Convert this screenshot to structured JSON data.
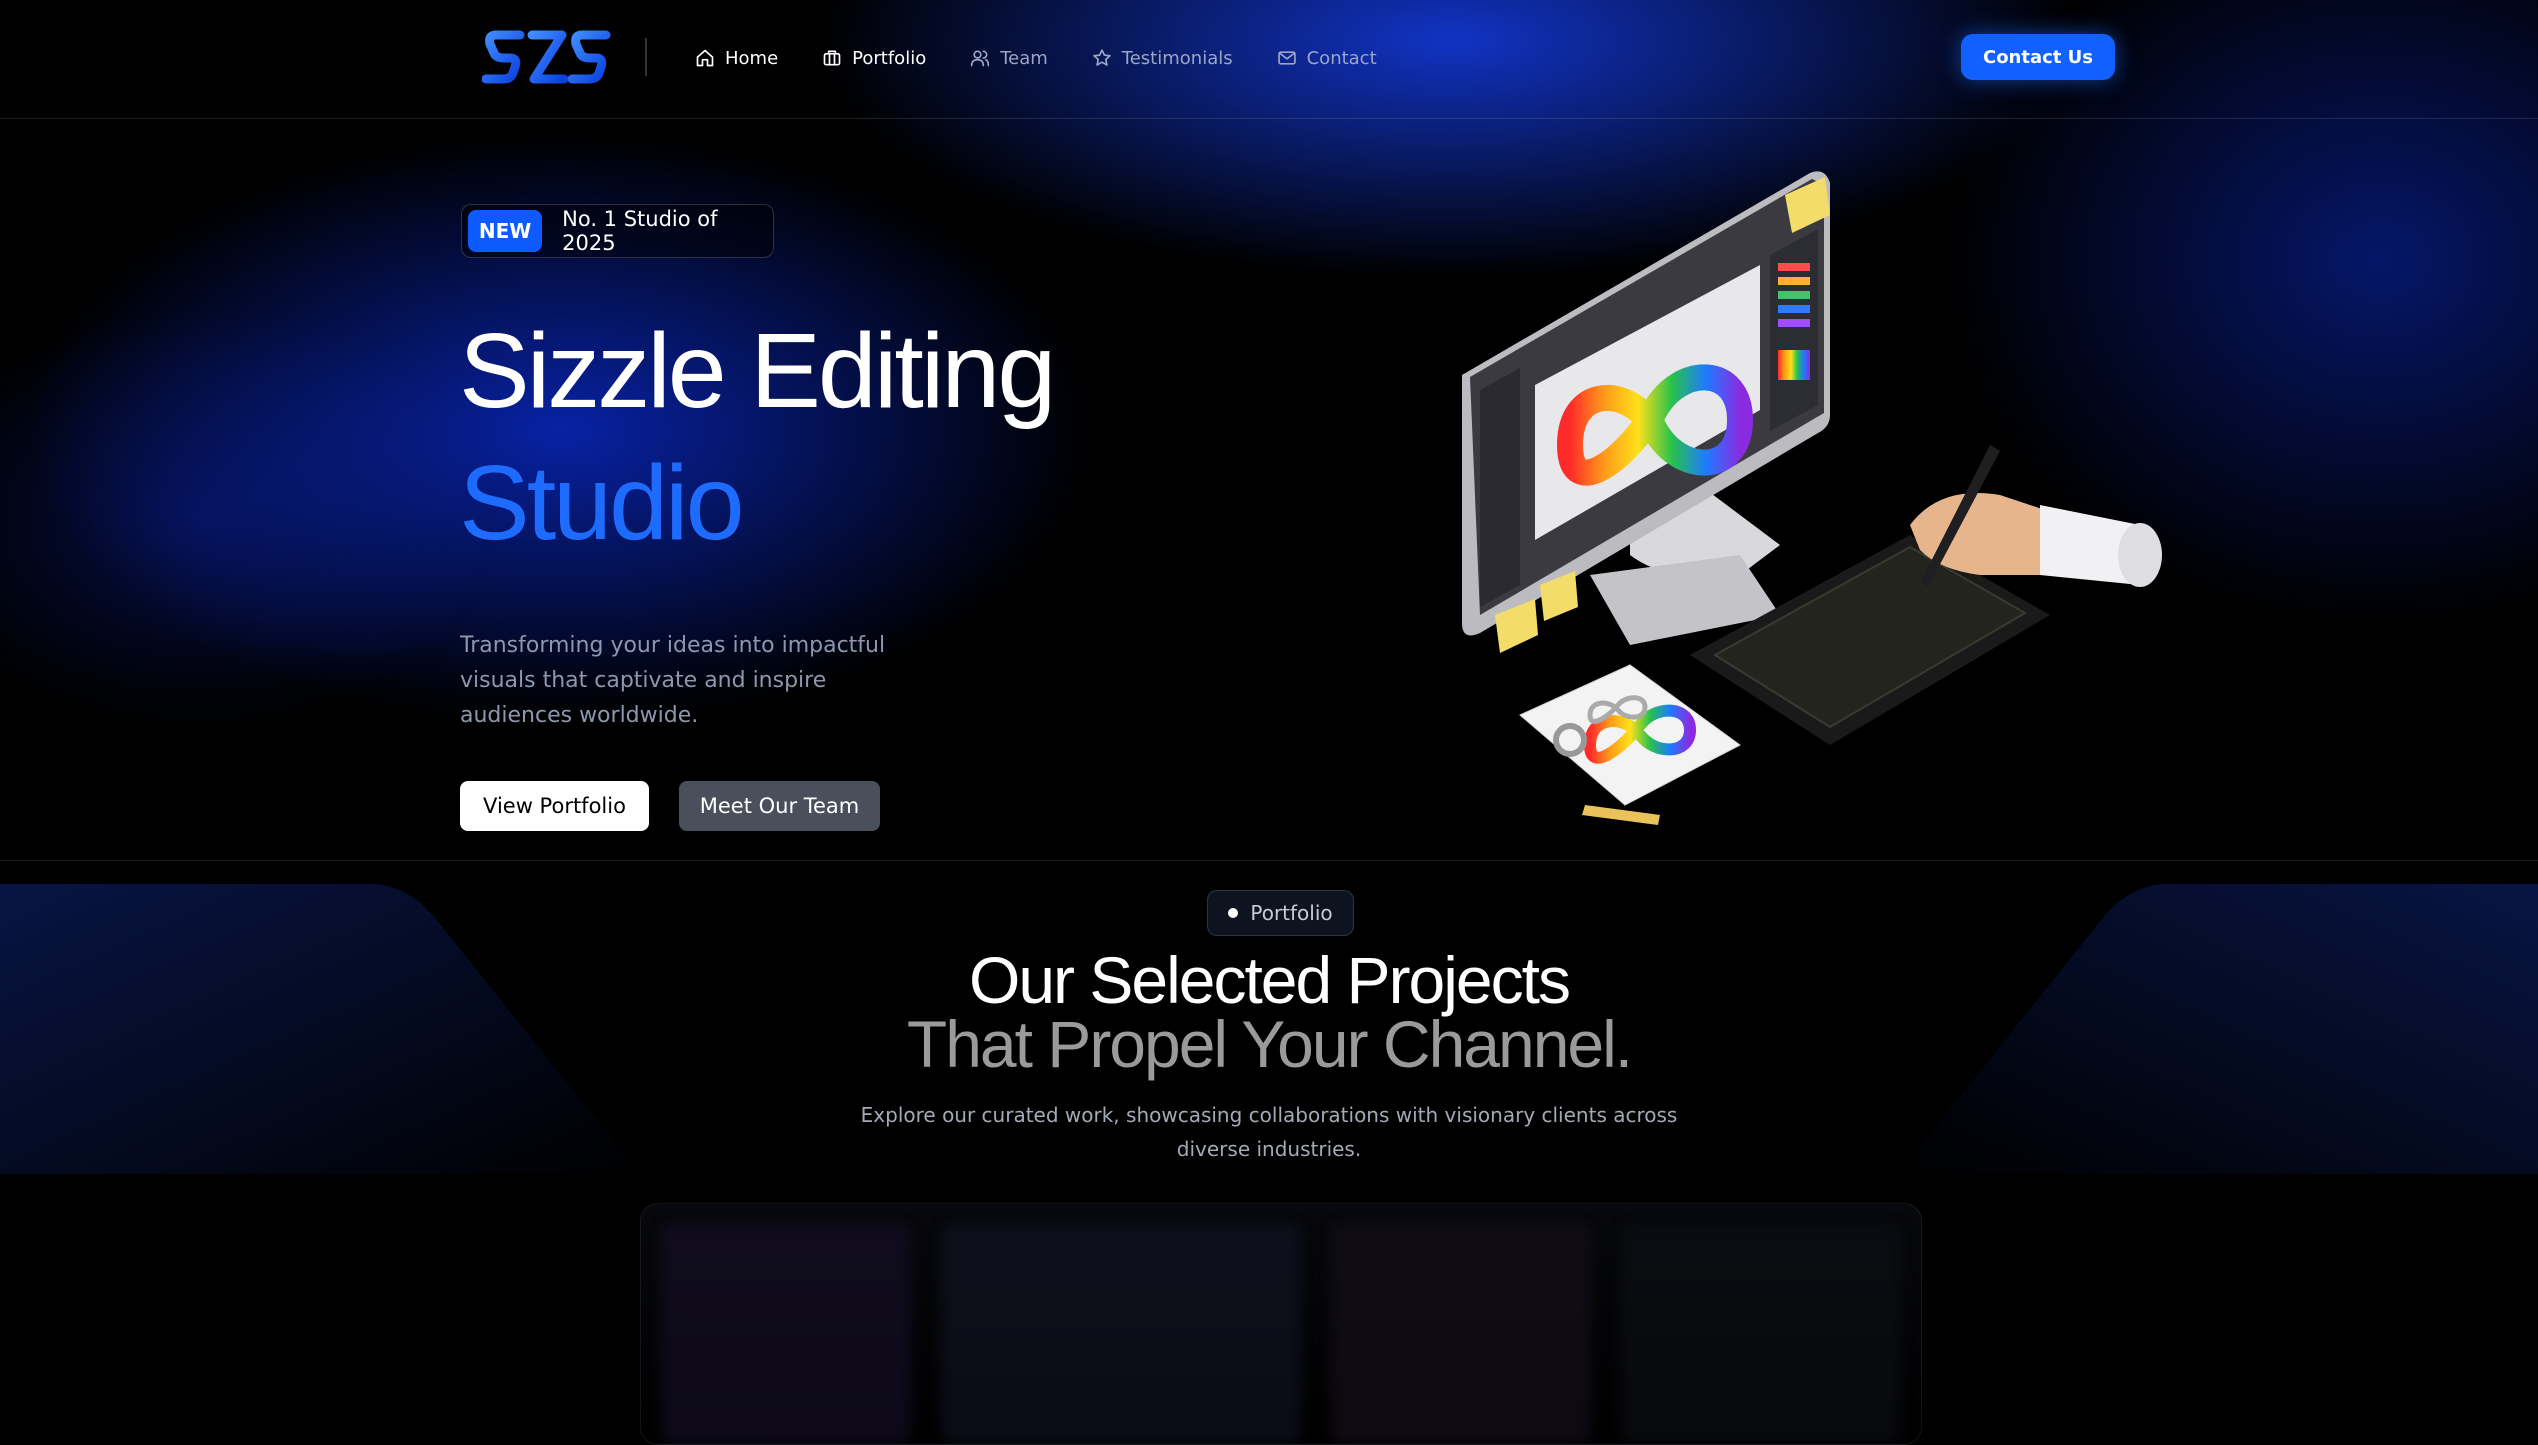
{
  "nav": {
    "logo_text": "SZS",
    "items": [
      {
        "label": "Home",
        "icon": "home-icon",
        "active": true
      },
      {
        "label": "Portfolio",
        "icon": "briefcase-icon",
        "active": false
      },
      {
        "label": "Team",
        "icon": "users-icon",
        "active": false
      },
      {
        "label": "Testimonials",
        "icon": "star-icon",
        "active": false
      },
      {
        "label": "Contact",
        "icon": "mail-icon",
        "active": false
      }
    ],
    "cta_label": "Contact Us"
  },
  "hero": {
    "badge_new": "NEW",
    "badge_text": "No. 1 Studio of 2025",
    "title_line1": "Sizzle Editing",
    "title_line2": "Studio",
    "description": "Transforming your ideas into impactful visuals that captivate and inspire audiences worldwide.",
    "primary_button": "View Portfolio",
    "secondary_button": "Meet Our Team",
    "illustration": "isometric-designer-workstation"
  },
  "portfolio_section": {
    "pill_label": "Portfolio",
    "title_line1": "Our Selected Projects",
    "title_line2": "That Propel Your Channel.",
    "description": "Explore our curated work, showcasing collaborations with visionary clients across diverse industries."
  },
  "colors": {
    "accent": "#1160ff",
    "title_accent": "#1e6bff",
    "background": "#000000",
    "muted_text": "#8d97ad"
  }
}
